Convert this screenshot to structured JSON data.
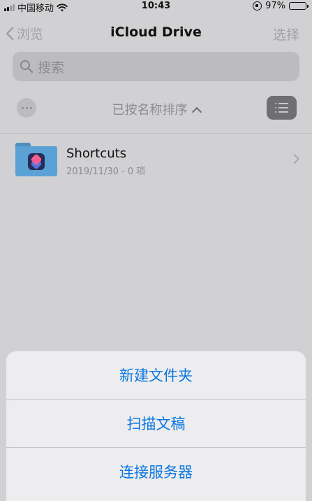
{
  "status_bar": {
    "carrier": "中国移动",
    "time": "10:43",
    "battery": "97%",
    "battery_level": 0.97
  },
  "nav": {
    "back_label": "浏览",
    "title": "iCloud Drive",
    "select_label": "选择"
  },
  "search": {
    "placeholder": "搜索"
  },
  "sort": {
    "label": "已按名称排序"
  },
  "files": [
    {
      "name": "Shortcuts",
      "meta": "2019/11/30 - 0 项",
      "icon": "folder-shortcuts-icon"
    }
  ],
  "action_sheet": {
    "items": [
      "新建文件夹",
      "扫描文稿",
      "连接服务器"
    ]
  },
  "colors": {
    "accent": "#0a76e0",
    "background": "#d1d1d3",
    "folder": "#5aa1d6"
  }
}
